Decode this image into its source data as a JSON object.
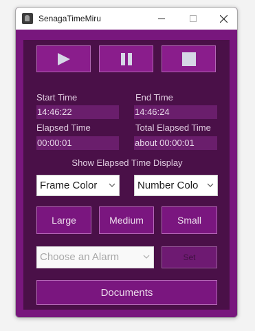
{
  "window": {
    "title": "SenagaTimeMiru"
  },
  "controls": {
    "play_icon": "play-icon",
    "pause_icon": "pause-icon",
    "stop_icon": "stop-icon"
  },
  "times": {
    "start_label": "Start Time",
    "start_value": "14:46:22",
    "end_label": "End Time",
    "end_value": "14:46:24",
    "elapsed_label": "Elapsed Time",
    "elapsed_value": "00:00:01",
    "total_label": "Total Elapsed Time",
    "total_value": "about 00:00:01"
  },
  "display": {
    "label": "Show Elapsed Time Display",
    "frame_color": "Frame Color",
    "number_color": "Number Colo"
  },
  "size_buttons": {
    "large": "Large",
    "medium": "Medium",
    "small": "Small"
  },
  "alarm": {
    "placeholder": "Choose an Alarm",
    "set": "Set"
  },
  "documents": "Documents",
  "colors": {
    "accent": "#7a167f",
    "panel": "#4a1048",
    "field": "#6a1e6c",
    "border": "#b467b6"
  }
}
